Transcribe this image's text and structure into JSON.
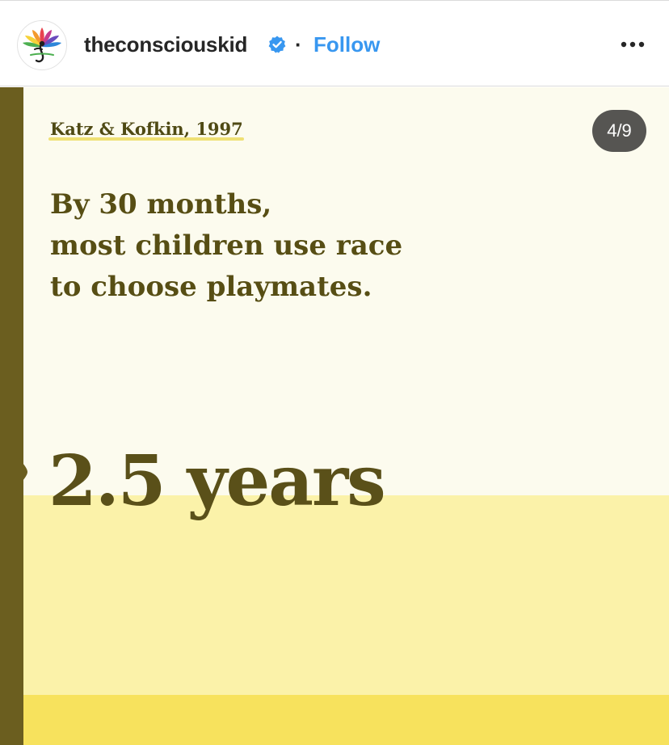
{
  "header": {
    "username": "theconsciouskid",
    "separator": "·",
    "follow_label": "Follow",
    "avatar_icon": "lotus-logo-icon",
    "verified_icon": "verified-badge-icon",
    "more_icon": "more-options-icon"
  },
  "post": {
    "slide_counter": "4/9",
    "citation": "Katz & Kofkin, 1997",
    "headline_lines": [
      "By 30 months,",
      "most children use race",
      "to choose playmates."
    ],
    "big_stat": "2.5 years"
  },
  "colors": {
    "accent_blue": "#3897f0",
    "olive_text": "#574e14",
    "sidebar_olive": "#6b5e1f",
    "pale_yellow": "#fbf2a9",
    "bright_yellow": "#f7e25d"
  }
}
